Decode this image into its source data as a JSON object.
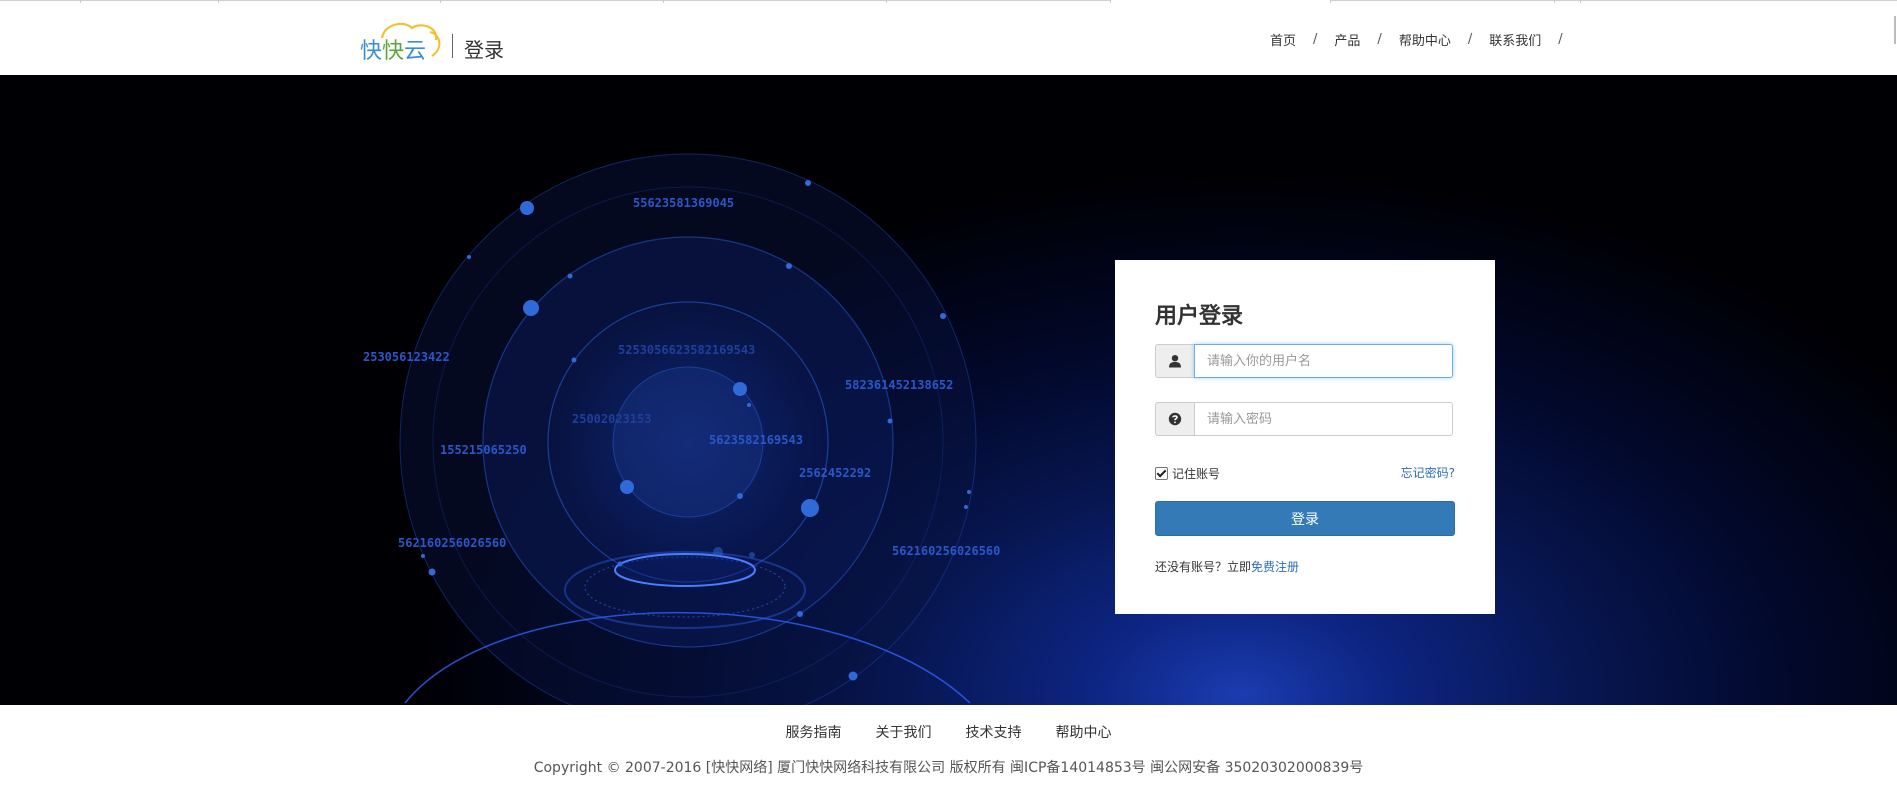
{
  "header": {
    "logo_text": "快快云",
    "page_title": "登录",
    "nav": [
      {
        "label": "首页",
        "sep": "/"
      },
      {
        "label": "产品",
        "sep": "/"
      },
      {
        "label": "帮助中心",
        "sep": "/"
      },
      {
        "label": "联系我们",
        "sep": "/"
      }
    ]
  },
  "hero": {
    "numbers": [
      "55623581369045",
      "253056123422",
      "525305662358216954З",
      "582361452138652",
      "25002023153",
      "155215065250",
      "5623582169543",
      "2562452292",
      "562160256026560",
      "562160256026560"
    ]
  },
  "login": {
    "title": "用户登录",
    "username_placeholder": "请输入你的用户名",
    "password_placeholder": "请输入密码",
    "remember_label": "记住账号",
    "remember_checked": true,
    "forgot_label": "忘记密码?",
    "submit_label": "登录",
    "register_prompt": "还没有账号？立即",
    "register_link": "免费注册"
  },
  "footer": {
    "links": [
      "服务指南",
      "关于我们",
      "技术支持",
      "帮助中心"
    ],
    "copyright": "Copyright © 2007-2016 [快快网络] 厦门快快网络科技有限公司 版权所有 闽ICP备14014853号 闽公网安备 35020302000839号"
  },
  "colors": {
    "primary_button": "#337ab7",
    "link": "#2a6ebb",
    "hero_dark": "#000004",
    "hero_glow": "#1b3cb0"
  },
  "icons": {
    "username": "user-icon",
    "password": "question-circle-icon"
  }
}
